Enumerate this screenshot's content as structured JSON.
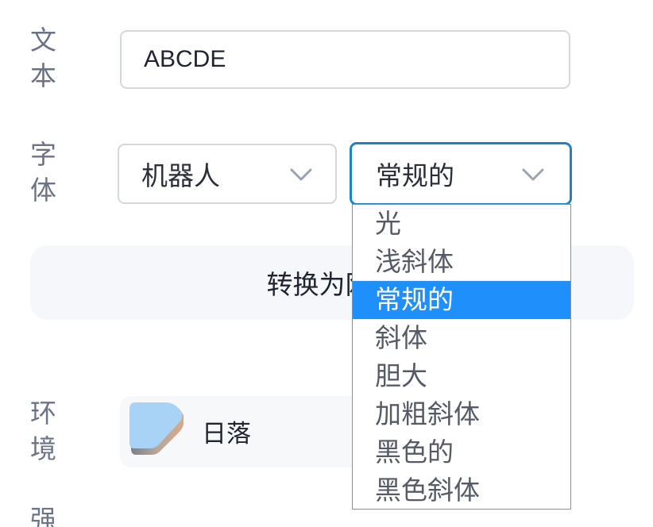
{
  "labels": {
    "text": "文本",
    "font": "字体",
    "environment": "环境",
    "strength": "强"
  },
  "text_input": {
    "value": "ABCDE"
  },
  "font_family": {
    "value": "机器人"
  },
  "font_weight": {
    "value": "常规的",
    "options": [
      "光",
      "浅斜体",
      "常规的",
      "斜体",
      "胆大",
      "加粗斜体",
      "黑色的",
      "黑色斜体"
    ],
    "selected_index": 2
  },
  "convert_button": {
    "label": "转换为网格"
  },
  "environment": {
    "name": "日落"
  },
  "colors": {
    "label": "#6b7487",
    "focus_border": "#1a84c4",
    "selected_option": "#1e8ffb",
    "button_bg": "#f5f7fa",
    "chevron": "#9aa3b2"
  },
  "icons": {
    "select_chevron": "chevron-down-icon",
    "environment_thumb": "environment-thumbnail"
  }
}
